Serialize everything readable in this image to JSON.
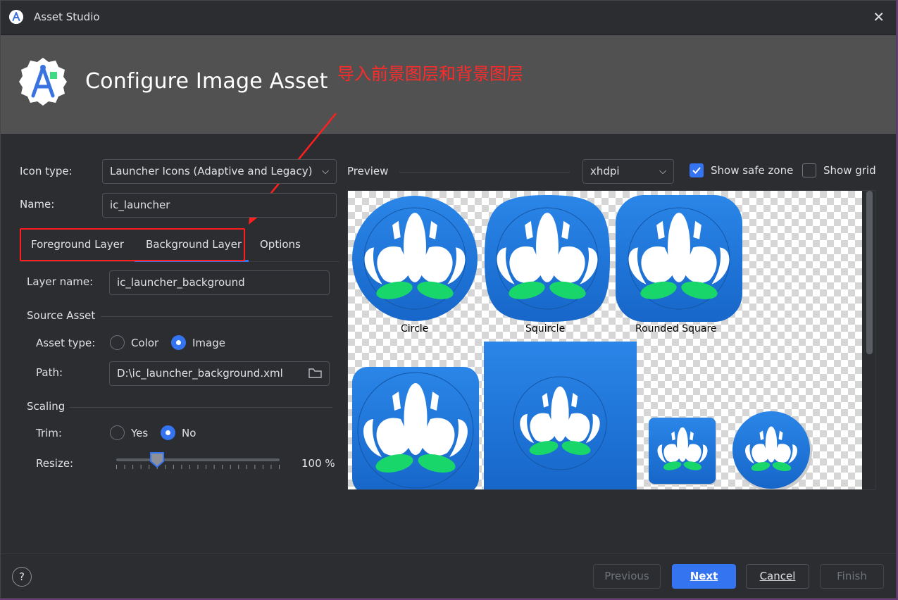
{
  "window": {
    "title": "Asset Studio"
  },
  "banner": {
    "title": "Configure Image Asset"
  },
  "annotation": {
    "text": "导入前景图层和背景图层",
    "color": "#ff2a2a"
  },
  "form": {
    "icon_type_label": "Icon type:",
    "icon_type_value": "Launcher Icons (Adaptive and Legacy)",
    "name_label": "Name:",
    "name_value": "ic_launcher"
  },
  "tabs": [
    {
      "label": "Foreground Layer",
      "selected": false
    },
    {
      "label": "Background Layer",
      "selected": true
    },
    {
      "label": "Options",
      "selected": false
    }
  ],
  "layer": {
    "layer_name_label": "Layer name:",
    "layer_name_value": "ic_launcher_background",
    "source_asset_heading": "Source Asset",
    "asset_type_label": "Asset type:",
    "asset_type_options": [
      "Color",
      "Image"
    ],
    "asset_type_selected": "Image",
    "path_label": "Path:",
    "path_value": "D:\\ic_launcher_background.xml",
    "scaling_heading": "Scaling",
    "trim_label": "Trim:",
    "trim_options": [
      "Yes",
      "No"
    ],
    "trim_selected": "No",
    "resize_label": "Resize:",
    "resize_value": "100 %",
    "resize_percent": 100
  },
  "preview": {
    "label": "Preview",
    "density_value": "xhdpi",
    "show_safe_zone_label": "Show safe zone",
    "show_safe_zone_checked": true,
    "show_grid_label": "Show grid",
    "show_grid_checked": false,
    "captions": [
      "Circle",
      "Squircle",
      "Rounded Square"
    ],
    "icon_colors": {
      "background": "#1e77d9",
      "petal": "#ffffff",
      "leaf": "#19d66b"
    }
  },
  "footer": {
    "help_label": "?",
    "previous_label": "Previous",
    "next_label": "Next",
    "cancel_label": "Cancel",
    "finish_label": "Finish"
  }
}
